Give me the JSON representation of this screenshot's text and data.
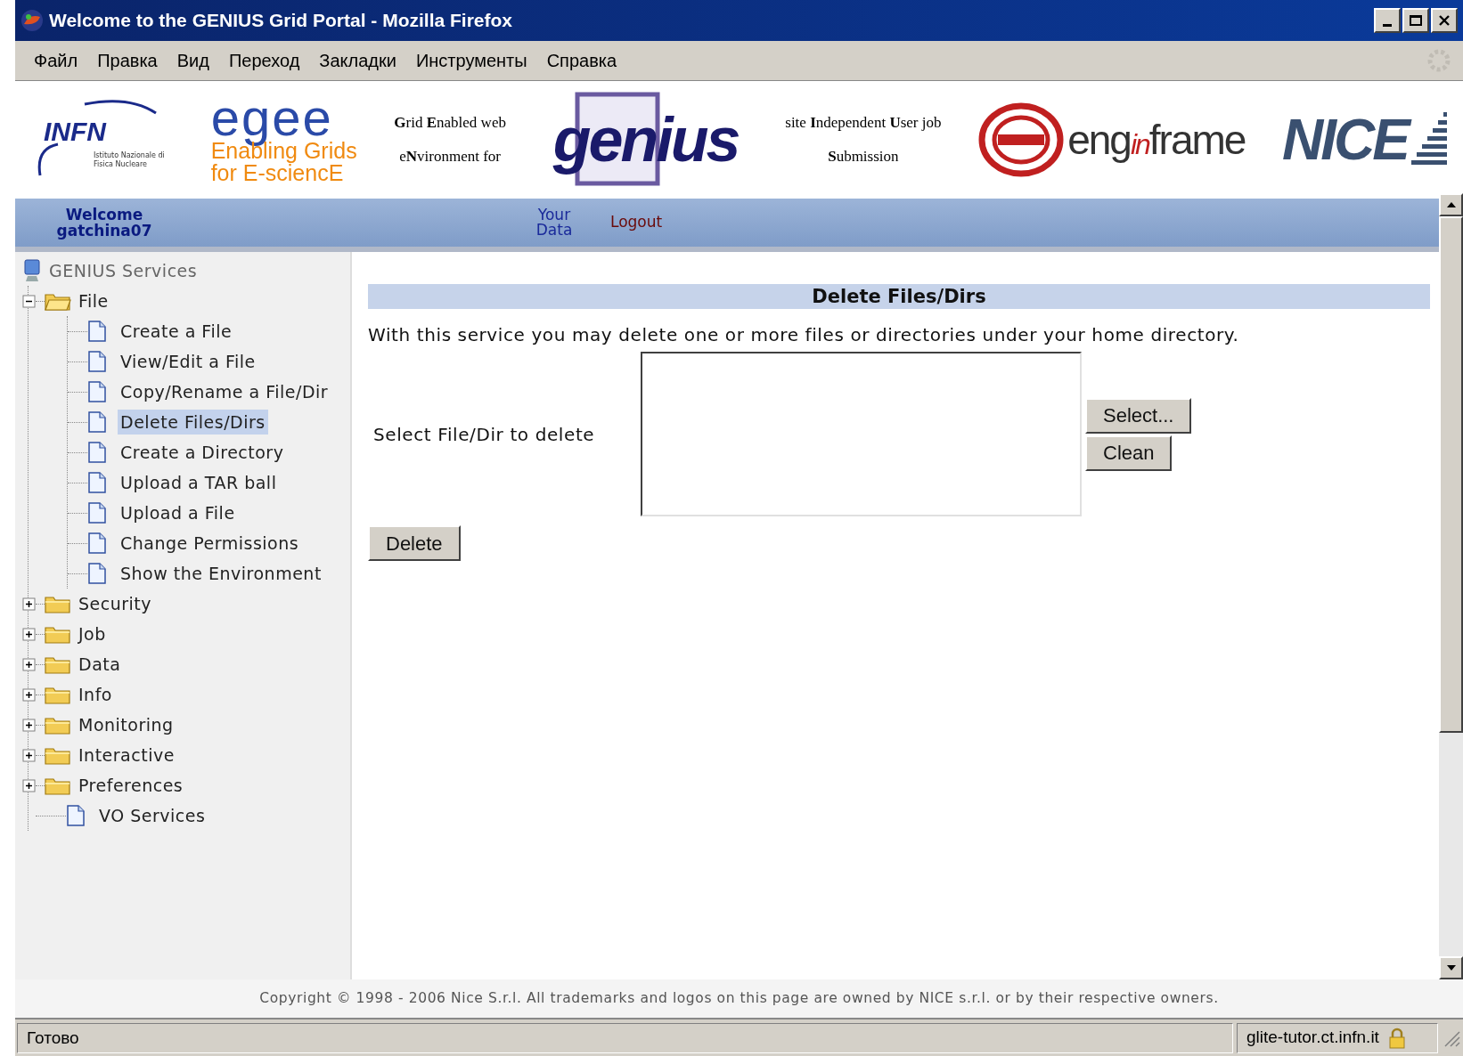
{
  "window": {
    "title": "Welcome to the GENIUS Grid Portal - Mozilla Firefox"
  },
  "menu": [
    "Файл",
    "Правка",
    "Вид",
    "Переход",
    "Закладки",
    "Инструменты",
    "Справка"
  ],
  "banner": {
    "infn": {
      "name": "INFN",
      "subtitle": "Istituto Nazionale di Fisica Nucleare"
    },
    "egee": {
      "name": "egee",
      "line1": "Enabling Grids",
      "line2": "for E-sciencE"
    },
    "genius_left": [
      "**G**rid **E**nabled web",
      "e**N**vironment for"
    ],
    "genius": "genius",
    "genius_right": [
      "site **I**ndependent **U**ser job",
      "**S**ubmission"
    ],
    "enginframe": [
      "eng",
      "in",
      "frame"
    ],
    "nice": "NICE"
  },
  "navbar": {
    "welcome": "Welcome",
    "user": "gatchina07",
    "links": [
      {
        "label": "Your Data",
        "kind": "data"
      },
      {
        "label": "Logout",
        "kind": "logout"
      }
    ]
  },
  "tree": {
    "root": "GENIUS Services",
    "items": [
      {
        "label": "File",
        "kind": "folder",
        "expanded": true,
        "selected": false,
        "children": [
          {
            "label": "Create a File",
            "kind": "file",
            "selected": false
          },
          {
            "label": "View/Edit a File",
            "kind": "file",
            "selected": false
          },
          {
            "label": "Copy/Rename a File/Dir",
            "kind": "file",
            "selected": false
          },
          {
            "label": "Delete Files/Dirs",
            "kind": "file",
            "selected": true
          },
          {
            "label": "Create a Directory",
            "kind": "file",
            "selected": false
          },
          {
            "label": "Upload a TAR ball",
            "kind": "file",
            "selected": false
          },
          {
            "label": "Upload a File",
            "kind": "file",
            "selected": false
          },
          {
            "label": "Change Permissions",
            "kind": "file",
            "selected": false
          },
          {
            "label": "Show the Environment",
            "kind": "file",
            "selected": false
          }
        ]
      },
      {
        "label": "Security",
        "kind": "folder",
        "expanded": false,
        "selected": false
      },
      {
        "label": "Job",
        "kind": "folder",
        "expanded": false,
        "selected": false
      },
      {
        "label": "Data",
        "kind": "folder",
        "expanded": false,
        "selected": false
      },
      {
        "label": "Info",
        "kind": "folder",
        "expanded": false,
        "selected": false
      },
      {
        "label": "Monitoring",
        "kind": "folder",
        "expanded": false,
        "selected": false
      },
      {
        "label": "Interactive",
        "kind": "folder",
        "expanded": false,
        "selected": false
      },
      {
        "label": "Preferences",
        "kind": "folder",
        "expanded": false,
        "selected": false
      },
      {
        "label": "VO Services",
        "kind": "file",
        "selected": false
      }
    ]
  },
  "main": {
    "heading": "Delete Files/Dirs",
    "description": "With this service you may delete one or more files or directories under your home directory.",
    "field_label": "Select File/Dir to delete",
    "side_buttons": [
      "Select...",
      "Clean"
    ],
    "submit": "Delete"
  },
  "footer": "Copyright © 1998 - 2006 Nice S.r.l. All trademarks and logos on this page are owned by NICE s.r.l. or by their respective owners.",
  "status_bar": {
    "text": "Готово",
    "host": "glite-tutor.ct.infn.it"
  }
}
